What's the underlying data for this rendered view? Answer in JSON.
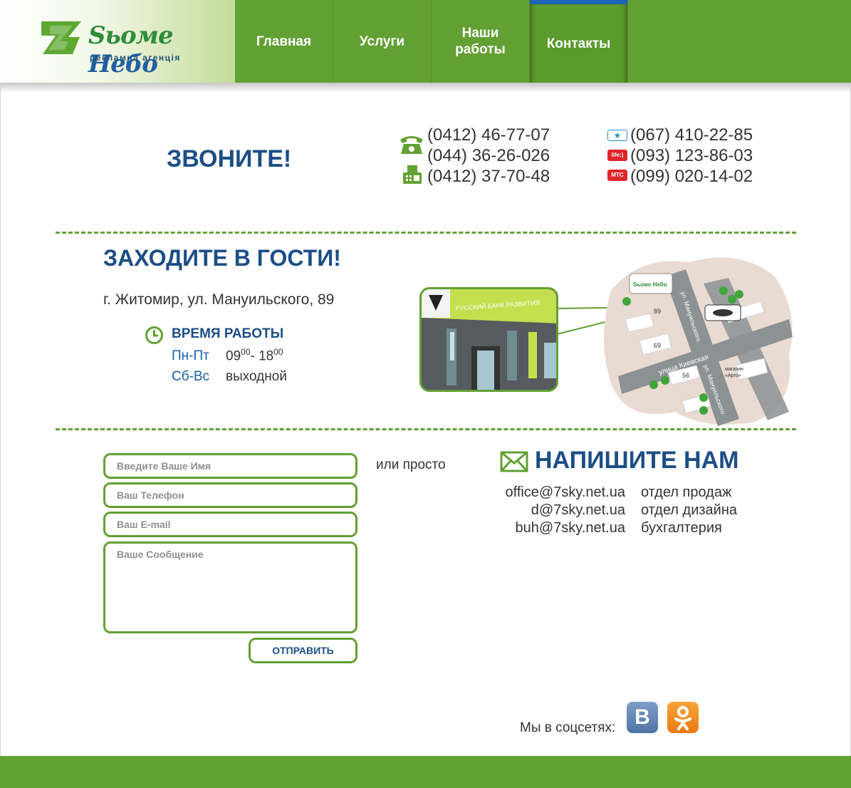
{
  "brand": {
    "name_part1": "Sьоме",
    "name_part2": "Небо",
    "subtitle": "рекламна агенція",
    "colors": {
      "green": "#62a033",
      "blue": "#1c4e86"
    }
  },
  "nav": {
    "items": [
      {
        "label": "Главная"
      },
      {
        "label": "Услуги"
      },
      {
        "label": "Наши работы"
      },
      {
        "label": "Контакты",
        "active": true
      }
    ]
  },
  "call": {
    "title": "ЗВОНИТЕ!",
    "landline": [
      "(0412) 46-77-07",
      "(044) 36-26-026",
      "(0412) 37-70-48"
    ],
    "landline_icons": [
      "phone-icon",
      "fax-icon"
    ],
    "mobile": [
      {
        "number": "(067) 410-22-85",
        "operator_icon": "kyivstar-icon"
      },
      {
        "number": "(093) 123-86-03",
        "operator_icon": "life-icon",
        "badge": "life:)"
      },
      {
        "number": "(099) 020-14-02",
        "operator_icon": "mts-icon",
        "badge": "МТС"
      }
    ]
  },
  "visit": {
    "title": "ЗАХОДИТЕ В ГОСТИ!",
    "address": "г. Житомир, ул. Мануильского, 89",
    "hours_title": "ВРЕМЯ РАБОТЫ",
    "weekdays": "Пн-Пт",
    "weekdays_from": "09",
    "weekdays_from_min": "00",
    "weekdays_sep": "- 18",
    "weekdays_to_min": "00",
    "weekend": "Сб-Вс",
    "weekend_value": "выходной",
    "photo_sign": "РУССКИЙ БАНК РАЗВИТИЯ",
    "map": {
      "street1": "ул. Мануильского",
      "street2": "улица Киевская",
      "street3": "ул. Мануильского",
      "house1": "89",
      "house2": "69",
      "house3": "56",
      "shop": "магазин «Арго»",
      "shop_line1": "магазин",
      "shop_line2": "«Арго»",
      "marker_label": "Sьоме Небо"
    }
  },
  "form": {
    "name_placeholder": "Введите Ваше Имя",
    "phone_placeholder": "Ваш Телефон",
    "email_placeholder": "Ваш E-mail",
    "message_placeholder": "Ваше Сообщение",
    "submit_label": "ОТПРАВИТЬ"
  },
  "contact": {
    "or_text": "или просто",
    "title": "НАПИШИТЕ НАМ",
    "emails": [
      {
        "address": "office@7sky.net.ua",
        "department": "отдел продаж"
      },
      {
        "address": "d@7sky.net.ua",
        "department": "отдел дизайна"
      },
      {
        "address": "buh@7sky.net.ua",
        "department": "бухгалтерия"
      }
    ]
  },
  "social": {
    "label": "Мы в соцсетях:",
    "items": [
      {
        "icon": "vk-icon",
        "glyph": "B"
      },
      {
        "icon": "odnoklassniki-icon"
      }
    ]
  }
}
